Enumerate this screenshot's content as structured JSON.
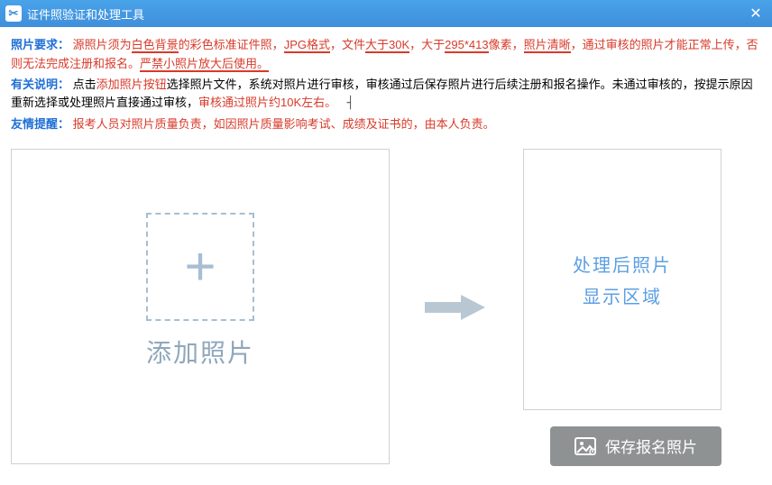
{
  "titlebar": {
    "icon_glyph": "✂",
    "title": "证件照验证和处理工具"
  },
  "instructions": {
    "line1_label": "照片要求：",
    "line1_a": "源照片须为",
    "line1_b": "白色背景",
    "line1_c": "的彩色标准证件照，",
    "line1_d": "JPG格式",
    "line1_e": "，文件",
    "line1_f": "大于30K",
    "line1_g": "，大于",
    "line1_h": "295*413",
    "line1_i": "像素，",
    "line1_j": "照片清晰",
    "line1_k": "，通过审核的照片才能正常上传，否则无法完成注册和报名。",
    "line1_l": "严禁小照片放大后使用。",
    "line2_label": "有关说明：",
    "line2_a": "点击",
    "line2_b": "添加照片按钮",
    "line2_c": "选择照片文件，系统对照片进行审核，审核通过后保存照片进行后续注册和报名操作。未通过审核的，按提示原因重新选择或处理照片直接通过审核，",
    "line2_d": "审核通过照片约10K左右。",
    "line3_label": "友情提醒：",
    "line3_a": "报考人员对照片质量负责，如因照片质量影响考试、成绩及证书的，由本人负责。"
  },
  "add_photo_label": "添加照片",
  "result_line1": "处理后照片",
  "result_line2": "显示区域",
  "save_button_label": "保存报名照片"
}
